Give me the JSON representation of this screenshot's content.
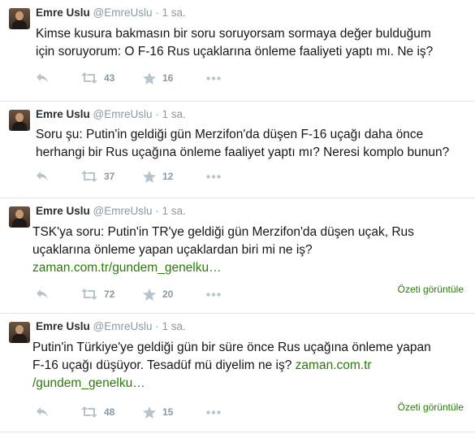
{
  "tweets": [
    {
      "name": "Emre Uslu",
      "handle": "@EmreUslu",
      "time": "· 1 sa.",
      "text": "Kimse kusura bakmasın bir soru soruyorsam sormaya değer bulduğum için soruyorum: O F-16 Rus uçaklarına önleme faaliyeti yaptı mı. Ne iş?",
      "retweets": "43",
      "favorites": "16"
    },
    {
      "name": "Emre Uslu",
      "handle": "@EmreUslu",
      "time": "· 1 sa.",
      "text": "Soru şu: Putin'in geldiği gün Merzifon'da düşen F-16 uçağı daha önce herhangi bir Rus uçağına önleme faaliyet yaptı mı? Neresi komplo bunun?",
      "retweets": "37",
      "favorites": "12"
    },
    {
      "name": "Emre Uslu",
      "handle": "@EmreUslu",
      "time": "· 1 sa.",
      "text": "TSK'ya soru: Putin'in TR'ye geldiği gün Merzifon'da düşen uçak, Rus uçaklarına önleme yapan uçaklardan biri mi ne iş?",
      "link": "zaman.com.tr/gundem_genelku…",
      "retweets": "72",
      "favorites": "20",
      "summary": "Özeti görüntüle"
    },
    {
      "name": "Emre Uslu",
      "handle": "@EmreUslu",
      "time": "· 1 sa.",
      "text": "Putin'in Türkiye'ye geldiği gün bir süre önce Rus uçağına önleme yapan F-16 uçağı düşüyor. Tesadüf mü diyelim ne iş?",
      "link": "zaman.com.tr /gundem_genelku…",
      "retweets": "48",
      "favorites": "15",
      "summary": "Özeti görüntüle"
    }
  ],
  "icons": {
    "reply": "reply-icon",
    "retweet": "retweet-icon",
    "favorite": "star-icon",
    "more": "more-icon"
  },
  "colors": {
    "link": "#2b7a0b",
    "meta": "#8899a6",
    "divider": "#e1e8ed"
  }
}
